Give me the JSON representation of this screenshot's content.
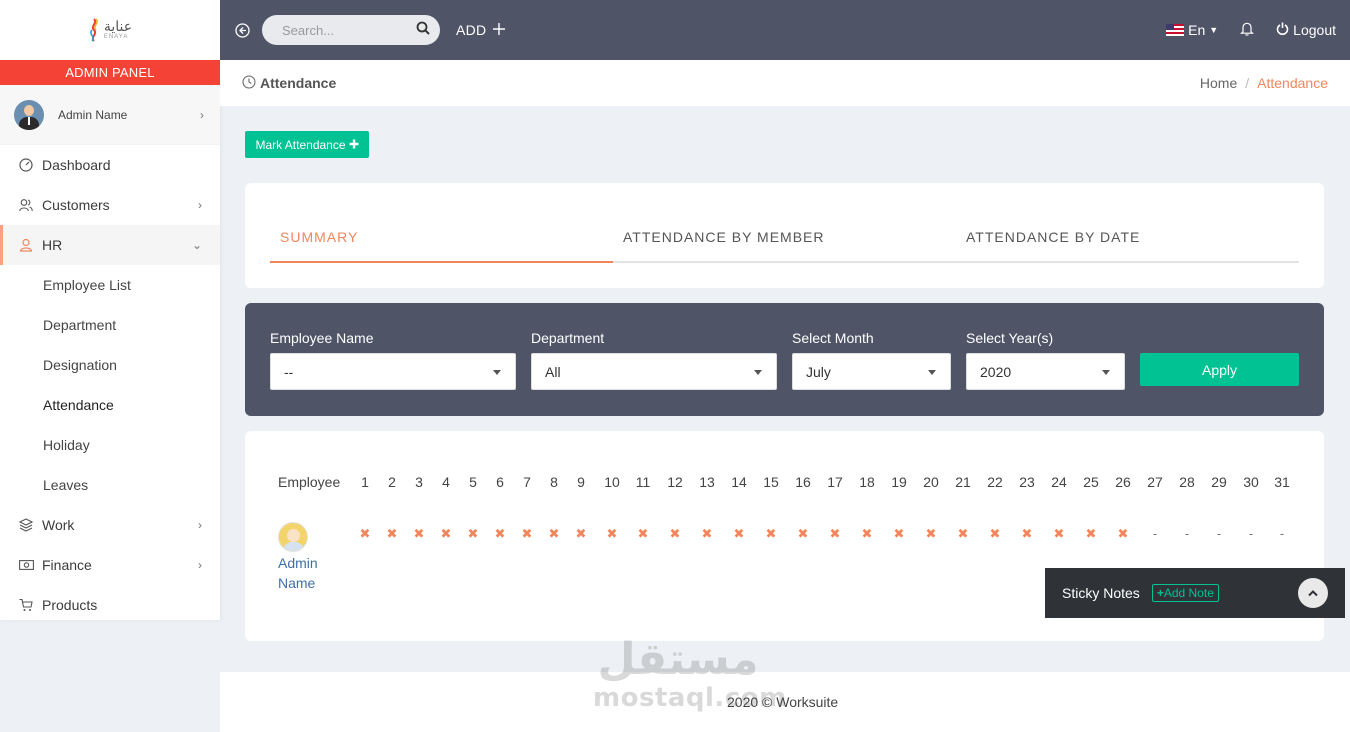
{
  "brand": {
    "logo_text": "عناية",
    "logo_sub": "ENAYA"
  },
  "sidebar": {
    "panel_label": "ADMIN PANEL",
    "profile_name": "Admin Name",
    "items": [
      {
        "label": "Dashboard",
        "icon": "dashboard-icon"
      },
      {
        "label": "Customers",
        "icon": "customers-icon"
      },
      {
        "label": "HR",
        "icon": "hr-icon"
      },
      {
        "label": "Work",
        "icon": "work-icon"
      },
      {
        "label": "Finance",
        "icon": "finance-icon"
      },
      {
        "label": "Products",
        "icon": "cart-icon"
      }
    ],
    "hr_sub": [
      "Employee List",
      "Department",
      "Designation",
      "Attendance",
      "Holiday",
      "Leaves"
    ]
  },
  "topbar": {
    "search_placeholder": "Search...",
    "add_label": "ADD",
    "lang": "En",
    "logout": "Logout"
  },
  "page": {
    "title": "Attendance",
    "breadcrumb": {
      "home": "Home",
      "current": "Attendance"
    },
    "mark_button": "Mark Attendance"
  },
  "tabs": [
    "SUMMARY",
    "ATTENDANCE BY MEMBER",
    "ATTENDANCE BY DATE"
  ],
  "filters": {
    "employee": {
      "label": "Employee Name",
      "value": "--"
    },
    "department": {
      "label": "Department",
      "value": "All"
    },
    "month": {
      "label": "Select Month",
      "value": "July"
    },
    "year": {
      "label": "Select Year(s)",
      "value": "2020"
    },
    "apply": "Apply"
  },
  "table": {
    "employee_header": "Employee",
    "days": [
      "1",
      "2",
      "3",
      "4",
      "5",
      "6",
      "7",
      "8",
      "9",
      "10",
      "11",
      "12",
      "13",
      "14",
      "15",
      "16",
      "17",
      "18",
      "19",
      "20",
      "21",
      "22",
      "23",
      "24",
      "25",
      "26",
      "27",
      "28",
      "29",
      "30",
      "31"
    ],
    "rows": [
      {
        "name_line1": "Admin",
        "name_line2": "Name",
        "marks": [
          "x",
          "x",
          "x",
          "x",
          "x",
          "x",
          "x",
          "x",
          "x",
          "x",
          "x",
          "x",
          "x",
          "x",
          "x",
          "x",
          "x",
          "x",
          "x",
          "x",
          "x",
          "x",
          "x",
          "x",
          "x",
          "x",
          "-",
          "-",
          "-",
          "-",
          "-"
        ]
      }
    ]
  },
  "sticky": {
    "title": "Sticky Notes",
    "add": "Add Note"
  },
  "footer": "2020 © Worksuite",
  "watermark": {
    "arabic": "مستقل",
    "latin": "mostaql.com"
  },
  "colors": {
    "accent": "#f0865c",
    "success": "#00c292",
    "topbar": "#4f5467",
    "danger": "#f44336"
  }
}
